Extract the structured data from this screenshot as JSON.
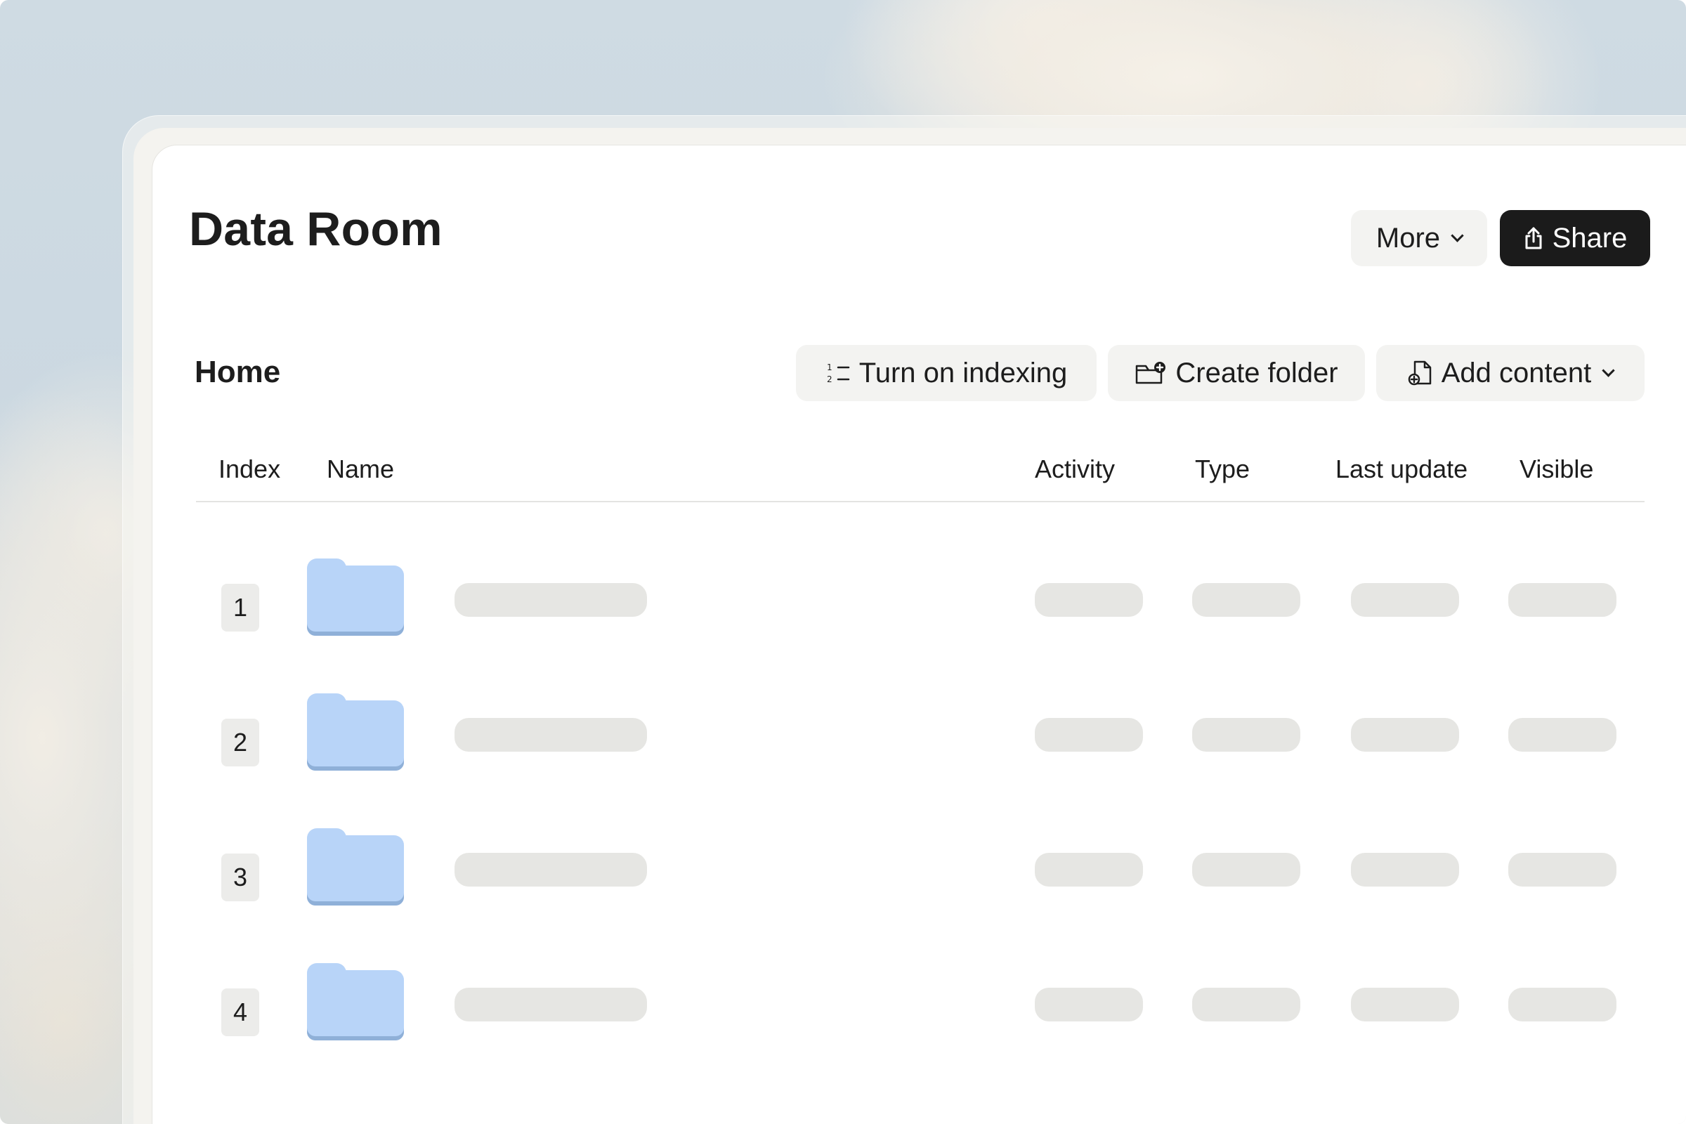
{
  "page": {
    "title": "Data Room"
  },
  "header_actions": {
    "more_label": "More",
    "share_label": "Share"
  },
  "section": {
    "title": "Home",
    "actions": {
      "indexing_label": "Turn on indexing",
      "create_folder_label": "Create folder",
      "add_content_label": "Add content"
    }
  },
  "table": {
    "columns": [
      "Index",
      "Name",
      "Activity",
      "Type",
      "Last update",
      "Visible"
    ],
    "rows": [
      {
        "index": "1",
        "type_icon": "folder-icon"
      },
      {
        "index": "2",
        "type_icon": "folder-icon"
      },
      {
        "index": "3",
        "type_icon": "folder-icon"
      },
      {
        "index": "4",
        "type_icon": "folder-icon"
      }
    ]
  },
  "icons": {
    "more": "chevron-down-icon",
    "share": "share-icon",
    "indexing": "numbered-list-icon",
    "create_folder": "folder-plus-icon",
    "add_content": "file-plus-icon"
  },
  "colors": {
    "primary_button": "#1b1b1b",
    "secondary_button": "#f3f3f1",
    "folder": "#b8d4f8",
    "skeleton": "#e6e6e3"
  }
}
